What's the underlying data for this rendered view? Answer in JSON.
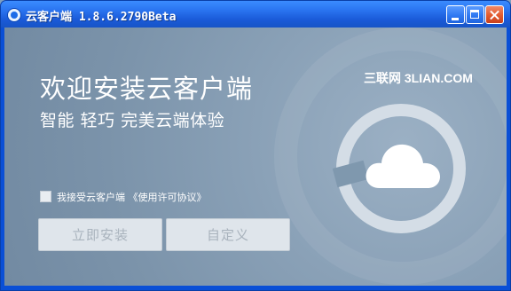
{
  "window": {
    "title": "云客户端 1.8.6.2790Beta",
    "buttons": {
      "minimize": "minimize",
      "maximize": "maximize",
      "close": "close"
    }
  },
  "main": {
    "heading": "欢迎安装云客户端",
    "subheading": "智能 轻巧 完美云端体验",
    "watermark": "三联网 3LIAN.COM",
    "agreement_label": "我接受云客户端 《使用许可协议》",
    "agreement_checked": false
  },
  "actions": {
    "install_label": "立即安装",
    "custom_label": "自定义"
  },
  "colors": {
    "title_bar": "#2a74f0",
    "content_background": "#8aa1b7",
    "button_background": "#dfe5eb",
    "button_text": "#a9b3bd"
  },
  "icons": {
    "app": "app-icon",
    "cloud": "cloud-icon"
  }
}
